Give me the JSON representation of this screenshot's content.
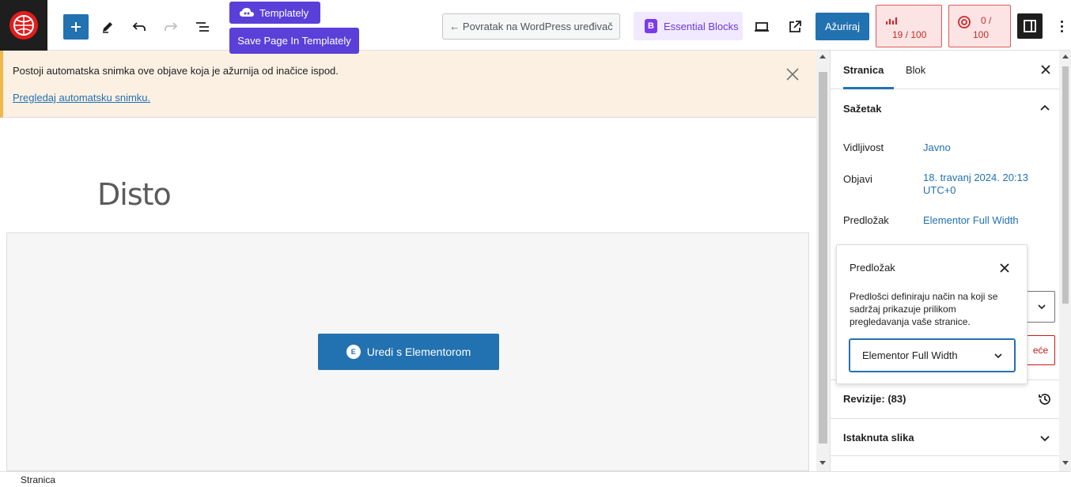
{
  "toolbar": {
    "templately_label": "Templately",
    "save_templately_label": "Save Page In Templately",
    "back_label": "← Povratak na WordPress uređivač",
    "essential_blocks_label": "Essential Blocks",
    "essential_blocks_icon_letter": "B",
    "update_label": "Ažuriraj",
    "seo_score": "19 / 100",
    "readability_score_top": "0 /",
    "readability_score_bottom": "100",
    "icons": [
      "logo-icon",
      "plus-icon",
      "pencil-icon",
      "undo-icon",
      "redo-icon",
      "list-view-icon",
      "cloud-icon",
      "desktop-preview-icon",
      "external-link-icon",
      "chart-icon",
      "at-icon",
      "sidebar-icon",
      "kebab-icon"
    ]
  },
  "colors": {
    "accent": "#2271b1",
    "templately": "#5b3fd9",
    "notice_bg": "#fcf0e3",
    "notice_border": "#f0b849",
    "score_bg": "#fde4e4",
    "score_border": "#e05a5a"
  },
  "notice": {
    "text": "Postoji automatska snimka ove objave koja je ažurnija od inačice ispod.",
    "link": "Pregledaj automatsku snimku."
  },
  "editor": {
    "page_title": "Disto",
    "elementor_button": "Uredi s Elementorom",
    "elementor_icon_letter": "E"
  },
  "sidebar": {
    "tab_page": "Stranica",
    "tab_block": "Blok",
    "summary_title": "Sažetak",
    "rows": [
      {
        "label": "Vidljivost",
        "value": "Javno"
      },
      {
        "label": "Objavi",
        "value": "18. travanj 2024. 20:13 UTC+0"
      },
      {
        "label": "Predložak",
        "value": "Elementor Full Width"
      }
    ],
    "trash_partial": "eće",
    "revisions": "Revizije: (83)",
    "featured_image": "Istaknuta slika"
  },
  "popover": {
    "title": "Predložak",
    "description": "Predlošci definiraju način na koji se sadržaj prikazuje prilikom pregledavanja vaše stranice.",
    "select_value": "Elementor Full Width"
  },
  "footer": {
    "breadcrumb": "Stranica"
  }
}
